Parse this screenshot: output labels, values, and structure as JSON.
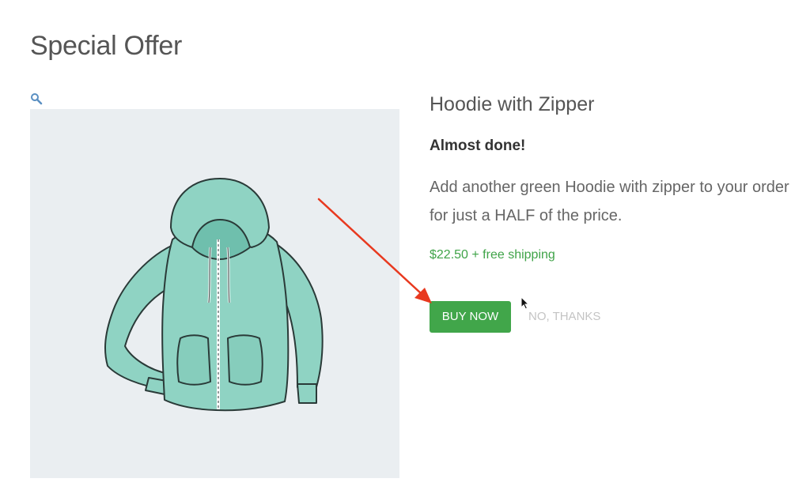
{
  "page": {
    "title": "Special Offer"
  },
  "gallery": {
    "zoom_icon": "magnifier-icon",
    "image": "green-zip-hoodie-illustration",
    "background_color": "#eaeef1",
    "hoodie_color": "#8fd3c3"
  },
  "offer": {
    "product_name": "Hoodie with Zipper",
    "headline": "Almost done!",
    "description": "Add another green Hoodie with zipper to your order for just a HALF of the price.",
    "price_text": "$22.50 + free shipping",
    "buy_label": "BUY NOW",
    "decline_label": "NO, THANKS"
  },
  "colors": {
    "accent_green": "#41a64a",
    "price_green": "#3fa348",
    "annotation_red": "#e8391f",
    "muted_text": "#c4c4c4"
  },
  "annotation": {
    "type": "arrow",
    "target": "buy-now-button"
  }
}
